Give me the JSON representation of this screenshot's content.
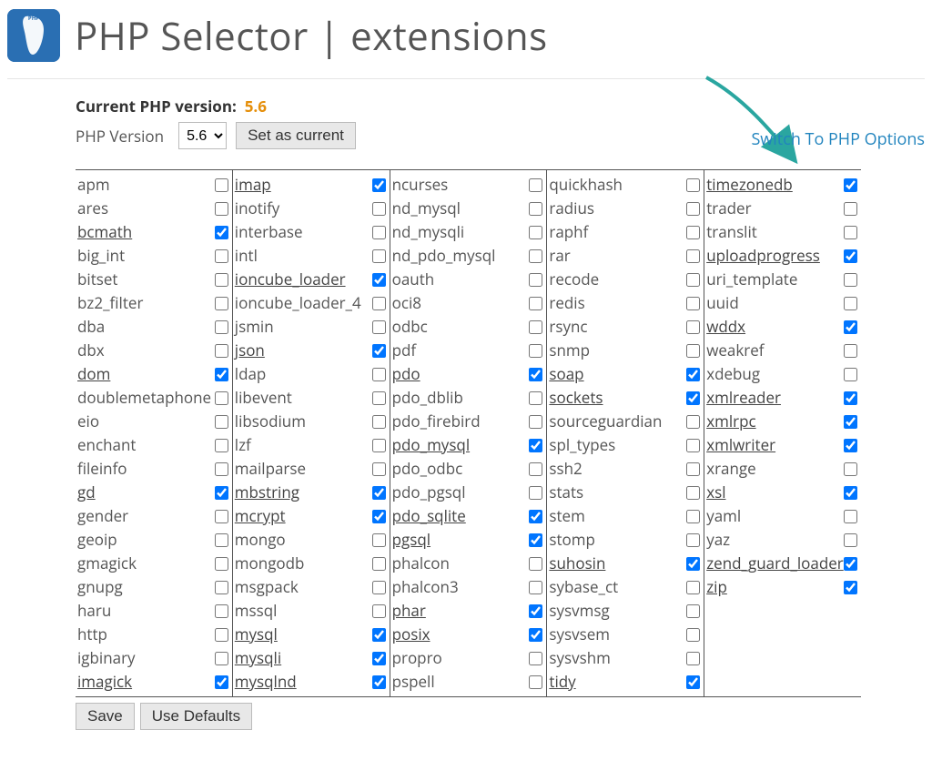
{
  "header": {
    "title": "PHP Selector | extensions"
  },
  "current_version": {
    "label": "Current PHP version:",
    "value": "5.6"
  },
  "version_selector": {
    "label": "PHP Version",
    "selected": "5.6",
    "button": "Set as current"
  },
  "switch_link": "Switch To PHP Options",
  "footer": {
    "save": "Save",
    "defaults": "Use Defaults"
  },
  "columns": [
    [
      {
        "name": "apm",
        "checked": false
      },
      {
        "name": "ares",
        "checked": false
      },
      {
        "name": "bcmath",
        "checked": true
      },
      {
        "name": "big_int",
        "checked": false
      },
      {
        "name": "bitset",
        "checked": false
      },
      {
        "name": "bz2_filter",
        "checked": false
      },
      {
        "name": "dba",
        "checked": false
      },
      {
        "name": "dbx",
        "checked": false
      },
      {
        "name": "dom",
        "checked": true
      },
      {
        "name": "doublemetaphone",
        "checked": false
      },
      {
        "name": "eio",
        "checked": false
      },
      {
        "name": "enchant",
        "checked": false
      },
      {
        "name": "fileinfo",
        "checked": false
      },
      {
        "name": "gd",
        "checked": true
      },
      {
        "name": "gender",
        "checked": false
      },
      {
        "name": "geoip",
        "checked": false
      },
      {
        "name": "gmagick",
        "checked": false
      },
      {
        "name": "gnupg",
        "checked": false
      },
      {
        "name": "haru",
        "checked": false
      },
      {
        "name": "http",
        "checked": false
      },
      {
        "name": "igbinary",
        "checked": false
      },
      {
        "name": "imagick",
        "checked": true
      }
    ],
    [
      {
        "name": "imap",
        "checked": true
      },
      {
        "name": "inotify",
        "checked": false
      },
      {
        "name": "interbase",
        "checked": false
      },
      {
        "name": "intl",
        "checked": false
      },
      {
        "name": "ioncube_loader",
        "checked": true
      },
      {
        "name": "ioncube_loader_4",
        "checked": false
      },
      {
        "name": "jsmin",
        "checked": false
      },
      {
        "name": "json",
        "checked": true
      },
      {
        "name": "ldap",
        "checked": false
      },
      {
        "name": "libevent",
        "checked": false
      },
      {
        "name": "libsodium",
        "checked": false
      },
      {
        "name": "lzf",
        "checked": false
      },
      {
        "name": "mailparse",
        "checked": false
      },
      {
        "name": "mbstring",
        "checked": true
      },
      {
        "name": "mcrypt",
        "checked": true
      },
      {
        "name": "mongo",
        "checked": false
      },
      {
        "name": "mongodb",
        "checked": false
      },
      {
        "name": "msgpack",
        "checked": false
      },
      {
        "name": "mssql",
        "checked": false
      },
      {
        "name": "mysql",
        "checked": true
      },
      {
        "name": "mysqli",
        "checked": true
      },
      {
        "name": "mysqlnd",
        "checked": true
      }
    ],
    [
      {
        "name": "ncurses",
        "checked": false
      },
      {
        "name": "nd_mysql",
        "checked": false
      },
      {
        "name": "nd_mysqli",
        "checked": false
      },
      {
        "name": "nd_pdo_mysql",
        "checked": false
      },
      {
        "name": "oauth",
        "checked": false
      },
      {
        "name": "oci8",
        "checked": false
      },
      {
        "name": "odbc",
        "checked": false
      },
      {
        "name": "pdf",
        "checked": false
      },
      {
        "name": "pdo",
        "checked": true
      },
      {
        "name": "pdo_dblib",
        "checked": false
      },
      {
        "name": "pdo_firebird",
        "checked": false
      },
      {
        "name": "pdo_mysql",
        "checked": true
      },
      {
        "name": "pdo_odbc",
        "checked": false
      },
      {
        "name": "pdo_pgsql",
        "checked": false
      },
      {
        "name": "pdo_sqlite",
        "checked": true
      },
      {
        "name": "pgsql",
        "checked": true
      },
      {
        "name": "phalcon",
        "checked": false
      },
      {
        "name": "phalcon3",
        "checked": false
      },
      {
        "name": "phar",
        "checked": true
      },
      {
        "name": "posix",
        "checked": true
      },
      {
        "name": "propro",
        "checked": false
      },
      {
        "name": "pspell",
        "checked": false
      }
    ],
    [
      {
        "name": "quickhash",
        "checked": false
      },
      {
        "name": "radius",
        "checked": false
      },
      {
        "name": "raphf",
        "checked": false
      },
      {
        "name": "rar",
        "checked": false
      },
      {
        "name": "recode",
        "checked": false
      },
      {
        "name": "redis",
        "checked": false
      },
      {
        "name": "rsync",
        "checked": false
      },
      {
        "name": "snmp",
        "checked": false
      },
      {
        "name": "soap",
        "checked": true
      },
      {
        "name": "sockets",
        "checked": true
      },
      {
        "name": "sourceguardian",
        "checked": false
      },
      {
        "name": "spl_types",
        "checked": false
      },
      {
        "name": "ssh2",
        "checked": false
      },
      {
        "name": "stats",
        "checked": false
      },
      {
        "name": "stem",
        "checked": false
      },
      {
        "name": "stomp",
        "checked": false
      },
      {
        "name": "suhosin",
        "checked": true
      },
      {
        "name": "sybase_ct",
        "checked": false
      },
      {
        "name": "sysvmsg",
        "checked": false
      },
      {
        "name": "sysvsem",
        "checked": false
      },
      {
        "name": "sysvshm",
        "checked": false
      },
      {
        "name": "tidy",
        "checked": true
      }
    ],
    [
      {
        "name": "timezonedb",
        "checked": true
      },
      {
        "name": "trader",
        "checked": false
      },
      {
        "name": "translit",
        "checked": false
      },
      {
        "name": "uploadprogress",
        "checked": true
      },
      {
        "name": "uri_template",
        "checked": false
      },
      {
        "name": "uuid",
        "checked": false
      },
      {
        "name": "wddx",
        "checked": true
      },
      {
        "name": "weakref",
        "checked": false
      },
      {
        "name": "xdebug",
        "checked": false
      },
      {
        "name": "xmlreader",
        "checked": true
      },
      {
        "name": "xmlrpc",
        "checked": true
      },
      {
        "name": "xmlwriter",
        "checked": true
      },
      {
        "name": "xrange",
        "checked": false
      },
      {
        "name": "xsl",
        "checked": true
      },
      {
        "name": "yaml",
        "checked": false
      },
      {
        "name": "yaz",
        "checked": false
      },
      {
        "name": "zend_guard_loader",
        "checked": true
      },
      {
        "name": "zip",
        "checked": true
      }
    ]
  ]
}
